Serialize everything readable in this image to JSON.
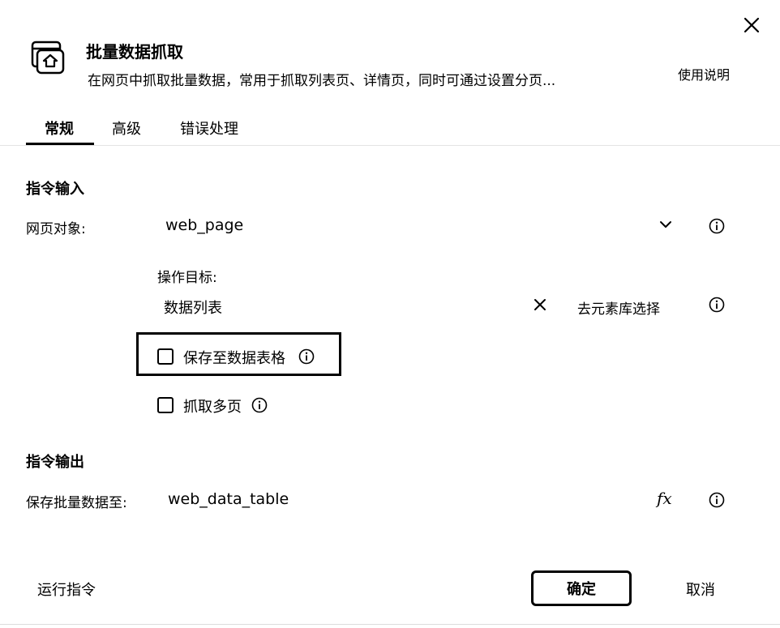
{
  "header": {
    "title": "批量数据抓取",
    "subtitle": "在网页中抓取批量数据，常用于抓取列表页、详情页，同时可通过设置分页...",
    "help_link": "使用说明",
    "app_icon": "browser-window-upload-icon",
    "close_icon": "close-icon"
  },
  "tabs": [
    {
      "label": "常规",
      "active": true
    },
    {
      "label": "高级",
      "active": false
    },
    {
      "label": "错误处理",
      "active": false
    }
  ],
  "input_section": {
    "title": "指令输入",
    "web_page_label": "网页对象:",
    "web_page_value": "web_page",
    "target_label": "操作目标:",
    "target_value": "数据列表",
    "target_pick_link": "去元素库选择",
    "save_to_table_label": "保存至数据表格",
    "save_to_table_checked": false,
    "multi_page_label": "抓取多页",
    "multi_page_checked": false
  },
  "output_section": {
    "title": "指令输出",
    "save_label": "保存批量数据至:",
    "save_value": "web_data_table",
    "fx_label": "fx"
  },
  "footer": {
    "run_label": "运行指令",
    "ok_label": "确定",
    "cancel_label": "取消"
  }
}
